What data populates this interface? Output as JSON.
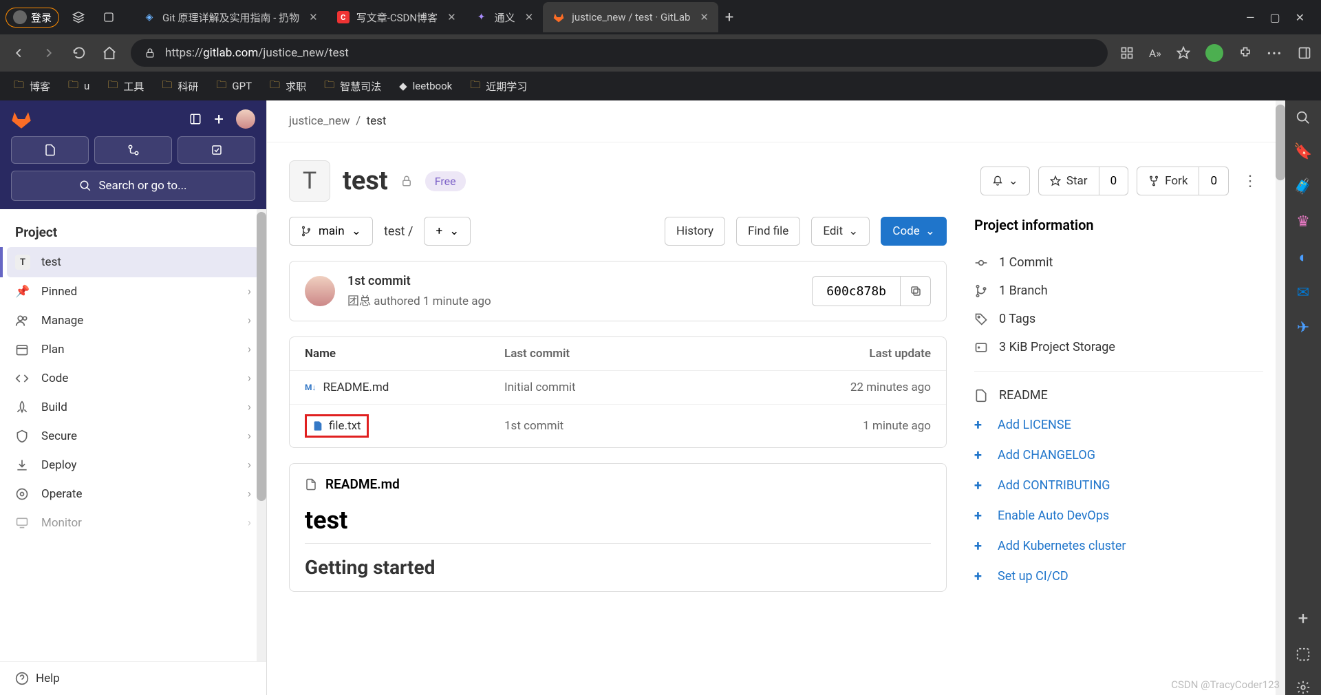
{
  "browser": {
    "login_label": "登录",
    "tabs": [
      {
        "title": "Git 原理详解及实用指南 - 扔物",
        "fav": "book"
      },
      {
        "title": "写文章-CSDN博客",
        "fav": "csdn"
      },
      {
        "title": "通义",
        "fav": "tongyi"
      },
      {
        "title": "justice_new / test · GitLab",
        "fav": "gitlab",
        "active": true
      }
    ],
    "url_prefix": "https://",
    "url_domain": "gitlab.com",
    "url_path": "/justice_new/test",
    "bookmarks": [
      "博客",
      "u",
      "工具",
      "科研",
      "GPT",
      "求职",
      "智慧司法",
      "leetbook",
      "近期学习"
    ]
  },
  "sidebar": {
    "search_label": "Search or go to...",
    "section": "Project",
    "project_name": "test",
    "project_letter": "T",
    "items": [
      {
        "label": "Pinned",
        "icon": "pin"
      },
      {
        "label": "Manage",
        "icon": "users"
      },
      {
        "label": "Plan",
        "icon": "calendar"
      },
      {
        "label": "Code",
        "icon": "code"
      },
      {
        "label": "Build",
        "icon": "rocket"
      },
      {
        "label": "Secure",
        "icon": "shield"
      },
      {
        "label": "Deploy",
        "icon": "deploy"
      },
      {
        "label": "Operate",
        "icon": "operate"
      },
      {
        "label": "Monitor",
        "icon": "monitor"
      }
    ],
    "help": "Help"
  },
  "breadcrumb": {
    "owner": "justice_new",
    "project": "test"
  },
  "project": {
    "letter": "T",
    "name": "test",
    "badge": "Free",
    "star_label": "Star",
    "star_count": "0",
    "fork_label": "Fork",
    "fork_count": "0"
  },
  "repobar": {
    "branch": "main",
    "path": "test",
    "history": "History",
    "find": "Find file",
    "edit": "Edit",
    "code": "Code"
  },
  "commit": {
    "title": "1st commit",
    "author": "团总",
    "authored": "authored 1 minute ago",
    "sha": "600c878b"
  },
  "table": {
    "name": "Name",
    "last": "Last commit",
    "update": "Last update",
    "rows": [
      {
        "file": "README.md",
        "commit": "Initial commit",
        "update": "22 minutes ago",
        "icon": "md"
      },
      {
        "file": "file.txt",
        "commit": "1st commit",
        "update": "1 minute ago",
        "icon": "txt",
        "highlight": true
      }
    ]
  },
  "readme": {
    "file": "README.md",
    "h1": "test",
    "h2": "Getting started"
  },
  "info": {
    "title": "Project information",
    "items": [
      {
        "label": "1 Commit",
        "icon": "commit"
      },
      {
        "label": "1 Branch",
        "icon": "branch"
      },
      {
        "label": "0 Tags",
        "icon": "tag"
      },
      {
        "label": "3 KiB Project Storage",
        "icon": "storage"
      }
    ],
    "readme": "README",
    "actions": [
      "Add LICENSE",
      "Add CHANGELOG",
      "Add CONTRIBUTING",
      "Enable Auto DevOps",
      "Add Kubernetes cluster",
      "Set up CI/CD"
    ]
  },
  "watermark": "CSDN @TracyCoder123"
}
